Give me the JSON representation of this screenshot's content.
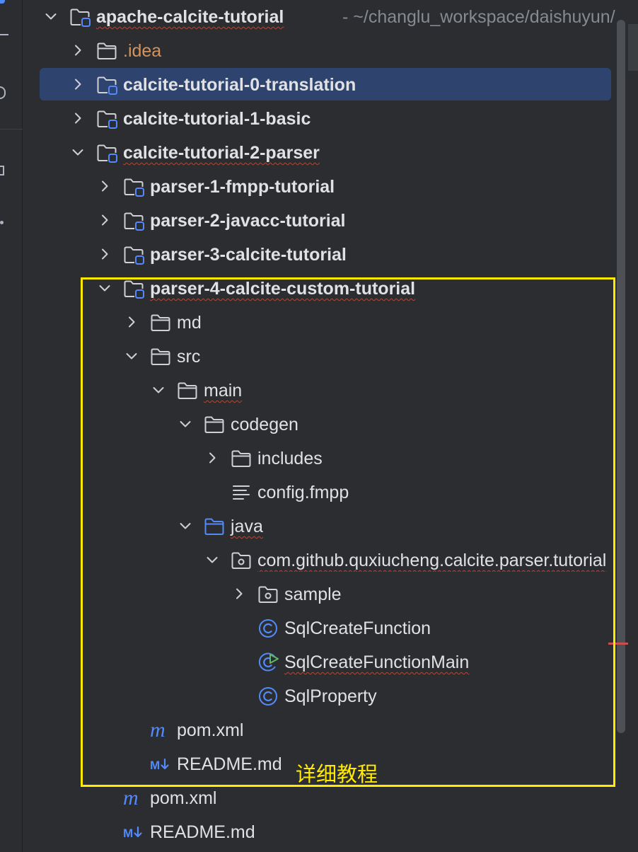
{
  "tree": {
    "root": {
      "label": "apache-calcite-tutorial",
      "path": "- ~/changlu_workspace/daishuyun/c"
    },
    "items": [
      {
        "label": ".idea"
      },
      {
        "label": "calcite-tutorial-0-translation"
      },
      {
        "label": "calcite-tutorial-1-basic"
      },
      {
        "label": "calcite-tutorial-2-parser"
      },
      {
        "label": "parser-1-fmpp-tutorial"
      },
      {
        "label": "parser-2-javacc-tutorial"
      },
      {
        "label": "parser-3-calcite-tutorial"
      },
      {
        "label": "parser-4-calcite-custom-tutorial"
      },
      {
        "label": "md"
      },
      {
        "label": "src"
      },
      {
        "label": "main"
      },
      {
        "label": "codegen"
      },
      {
        "label": "includes"
      },
      {
        "label": "config.fmpp"
      },
      {
        "label": "java"
      },
      {
        "label": "com.github.quxiucheng.calcite.parser.tutorial"
      },
      {
        "label": "sample"
      },
      {
        "label": "SqlCreateFunction"
      },
      {
        "label": "SqlCreateFunctionMain"
      },
      {
        "label": "SqlProperty"
      },
      {
        "label": "pom.xml"
      },
      {
        "label": "README.md"
      },
      {
        "label": "pom.xml"
      },
      {
        "label": "README.md"
      }
    ]
  },
  "annotation": {
    "text": "详细教程"
  },
  "colors": {
    "background": "#2b2d30",
    "selection": "#2e436e",
    "text": "#dfe1e5",
    "excluded_folder": "#d5935d",
    "source_folder": "#548af7",
    "highlight": "#ffea00"
  },
  "icons": {
    "collapsed": "chevron-right-icon",
    "expanded": "chevron-down-icon",
    "module": "module-folder-icon",
    "folder": "folder-icon",
    "source_root": "source-folder-icon",
    "package": "package-icon",
    "file": "text-file-icon",
    "class": "java-class-icon",
    "runnable_class": "java-runnable-class-icon",
    "maven": "maven-icon",
    "markdown": "markdown-icon"
  }
}
